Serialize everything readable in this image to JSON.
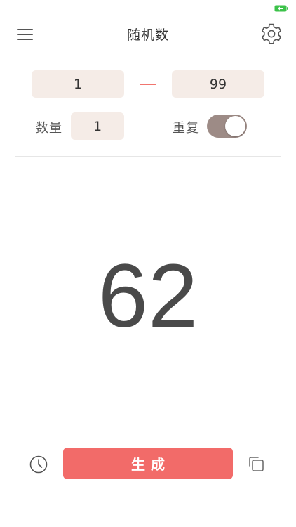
{
  "status_bar": {
    "battery_icon": "battery-charging-icon",
    "battery_color": "#3cc24a"
  },
  "header": {
    "title": "随机数",
    "menu_icon": "menu-icon",
    "settings_icon": "gear-icon"
  },
  "range": {
    "min_value": "1",
    "max_value": "99",
    "separator_color": "#f1756f"
  },
  "options": {
    "quantity_label": "数量",
    "quantity_value": "1",
    "repeat_label": "重复",
    "repeat_enabled": true
  },
  "result": {
    "value": "62"
  },
  "footer": {
    "history_icon": "clock-icon",
    "generate_label": "生成",
    "copy_icon": "copy-icon",
    "accent_color": "#f26b69"
  }
}
